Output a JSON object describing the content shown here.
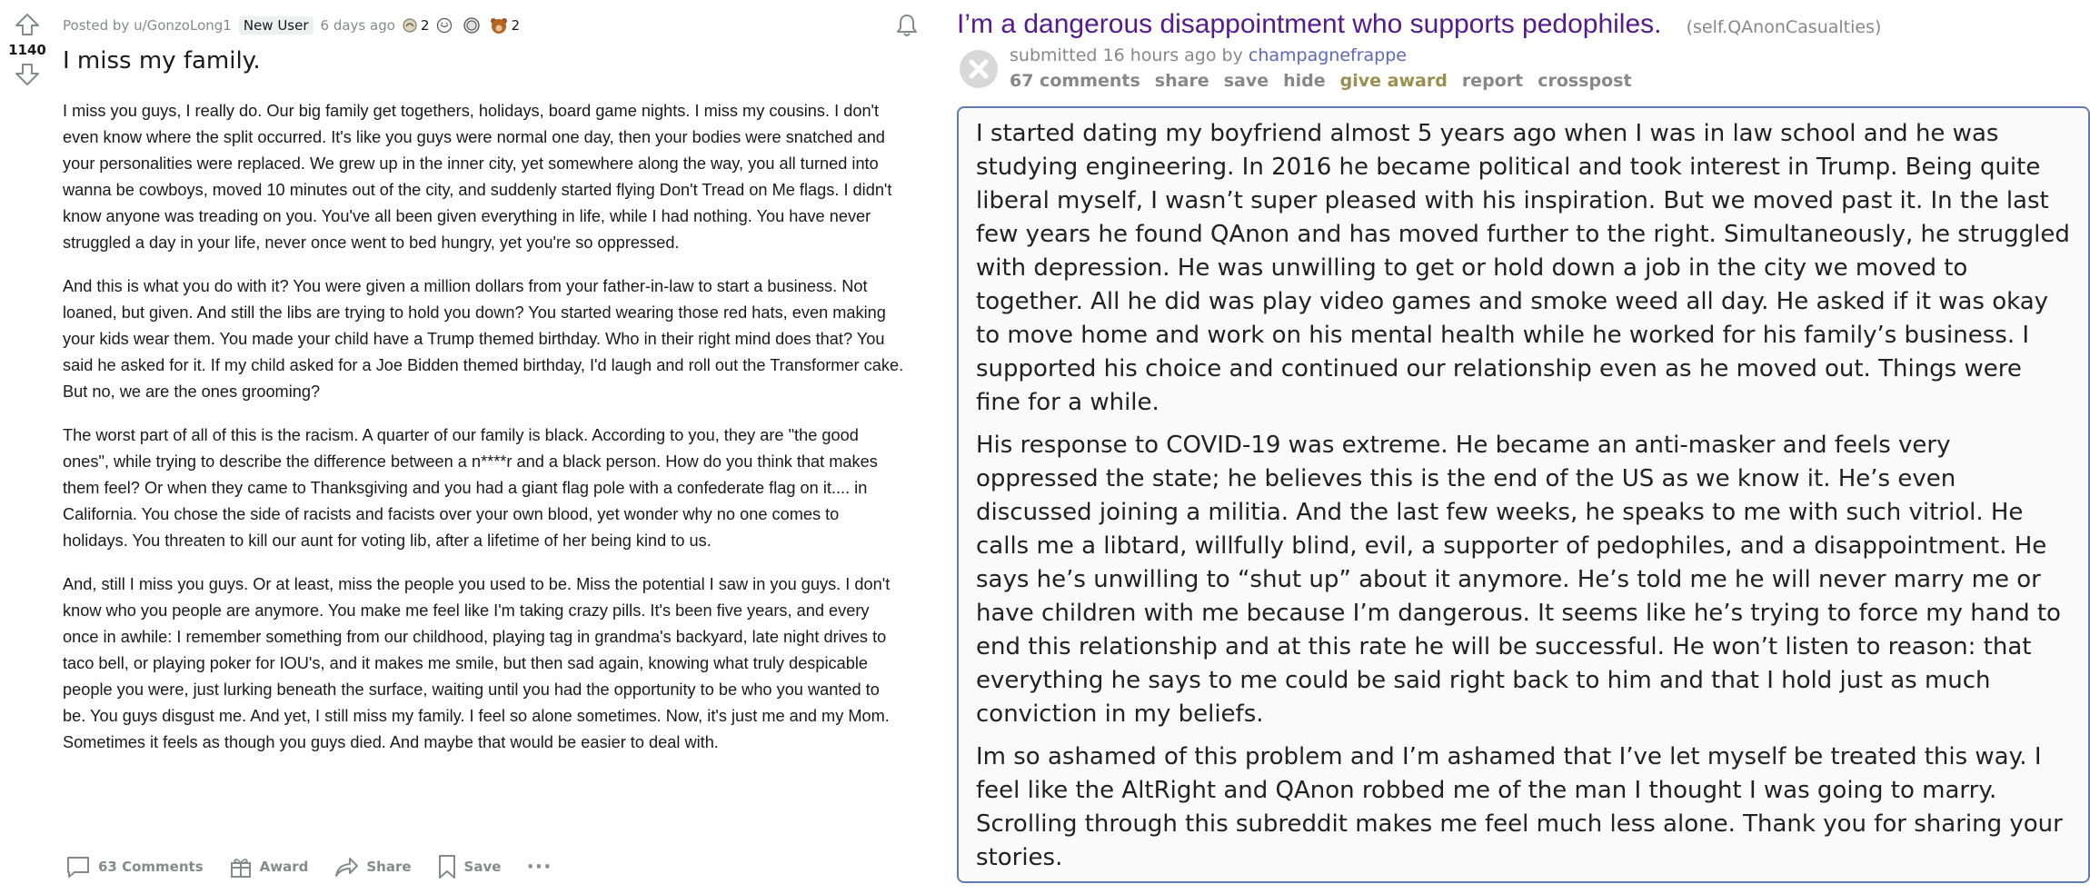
{
  "left_post": {
    "vote_count": "1140",
    "posted_by": "Posted by u/GonzoLong1",
    "flair": "New User",
    "age": "6 days ago",
    "awards": [
      {
        "icon": "helpful-award-icon",
        "count": "2"
      },
      {
        "icon": "wholesome-award-icon",
        "count": ""
      },
      {
        "icon": "silver-award-icon",
        "count": ""
      },
      {
        "icon": "bear-award-icon",
        "count": "2"
      }
    ],
    "title": "I miss my family.",
    "paragraphs": [
      "I miss you guys, I really do. Our big family get togethers, holidays, board game nights. I miss my cousins. I don't even know where the split occurred. It's like you guys were normal one day, then your bodies were snatched and your personalities were replaced. We grew up in the inner city, yet somewhere along the way, you all turned into wanna be cowboys, moved 10 minutes out of the city, and suddenly started flying Don't Tread on Me flags. I didn't know anyone was treading on you. You've all been given everything in life, while I had nothing. You have never struggled a day in your life, never once went to bed hungry, yet you're so oppressed.",
      "And this is what you do with it? You were given a million dollars from your father-in-law to start a business. Not loaned, but given. And still the libs are trying to hold you down? You started wearing those red hats, even making your kids wear them. You made your child have a Trump themed birthday. Who in their right mind does that? You said he asked for it. If my child asked for a Joe Bidden themed birthday, I'd laugh and roll out the Transformer cake. But no, we are the ones grooming?",
      "The worst part of all of this is the racism. A quarter of our family is black. According to you, they are \"the good ones\", while trying to describe the difference between a n****r and a black person. How do you think that makes them feel? Or when they came to Thanksgiving and you had a giant flag pole with a confederate flag on it.... in California. You chose the side of racists and facists over your own blood, yet wonder why no one comes to holidays. You threaten to kill our aunt for voting lib, after a lifetime of her being kind to us.",
      "And, still I miss you guys. Or at least, miss the people you used to be. Miss the potential I saw in you guys. I don't know who you people are anymore. You make me feel like I'm taking crazy pills. It's been five years, and every once in awhile: I remember something from our childhood, playing tag in grandma's backyard, late night drives to taco bell, or playing poker for IOU's, and it makes me smile, but then sad again, knowing what truly despicable people you were, just lurking beneath the surface, waiting until you had the opportunity to be who you wanted to be. You guys disgust me. And yet, I still miss my family. I feel so alone sometimes. Now, it's just me and my Mom. Sometimes it feels as though you guys died. And maybe that would be easier to deal with."
    ],
    "actions": {
      "comments": "63 Comments",
      "award": "Award",
      "share": "Share",
      "save": "Save",
      "more": "···"
    }
  },
  "right_post": {
    "title": "I’m a dangerous disappointment who supports pedophiles.",
    "domain": "(self.QAnonCasualties)",
    "submitted_prefix": "submitted 16 hours ago by",
    "author": "champagnefrappe",
    "buttons": [
      "67 comments",
      "share",
      "save",
      "hide",
      "give award",
      "report",
      "crosspost"
    ],
    "paragraphs": [
      "I started dating my boyfriend almost 5 years ago when I was in law school and he was studying engineering. In 2016 he became political and took interest in Trump. Being quite liberal myself, I wasn’t super pleased with his inspiration. But we moved past it. In the last few years he found QAnon and has moved further to the right. Simultaneously, he struggled with depression. He was unwilling to get or hold down a job in the city we moved to together. All he did was play video games and smoke weed all day. He asked if it was okay to move home and work on his mental health while he worked for his family’s business. I supported his choice and continued our relationship even as he moved out. Things were fine for a while.",
      "His response to COVID-19 was extreme. He became an anti-masker and feels very oppressed the state; he believes this is the end of the US as we know it. He’s even discussed joining a militia. And the last few weeks, he speaks to me with such vitriol. He calls me a libtard, willfully blind, evil, a supporter of pedophiles, and a disappointment. He says he’s unwilling to “shut up” about it anymore. He’s told me he will never marry me or have children with me because I’m dangerous. It seems like he’s trying to force my hand to end this relationship and at this rate he will be successful. He won’t listen to reason: that everything he says to me could be said right back to him and that I hold just as much conviction in my beliefs.",
      "Im so ashamed of this problem and I’m ashamed that I’ve let myself be treated this way. I feel like the AltRight and QAnon robbed me of the man I thought I was going to marry. Scrolling through this subreddit makes me feel much less alone. Thank you for sharing your stories."
    ]
  },
  "colors": {
    "old_title": "#551a8b",
    "old_author": "#5f68b8",
    "selftext_border": "#5f7bb5",
    "meta_gray": "#878a8c"
  }
}
